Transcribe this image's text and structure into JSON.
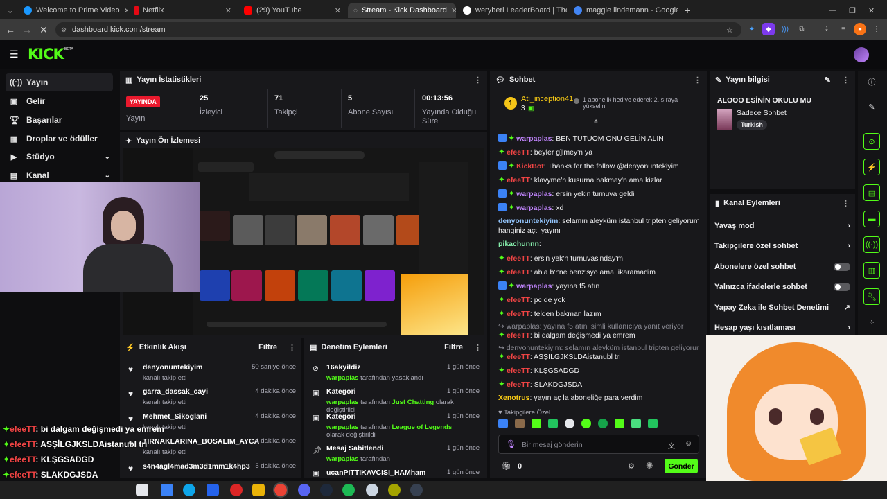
{
  "browser": {
    "tabs": [
      {
        "label": "Welcome to Prime Video",
        "color": "#1a98ff"
      },
      {
        "label": "Netflix",
        "color": "#e50914"
      },
      {
        "label": "(29) YouTube",
        "color": "#ff0000"
      },
      {
        "label": "Stream - Kick Dashboard",
        "color": "#53fc18"
      },
      {
        "label": "weryberi LeaderBoard | The be",
        "color": "#ffffff"
      },
      {
        "label": "maggie lindemann - Google'da",
        "color": "#4285f4"
      }
    ],
    "new_tab": "+",
    "url": "dashboard.kick.com/stream"
  },
  "header": {
    "logo": "KICK",
    "beta": "BETA"
  },
  "sidebar": {
    "items": [
      {
        "label": "Yayın",
        "icon": "live-icon"
      },
      {
        "label": "Gelir",
        "icon": "dollar-icon"
      },
      {
        "label": "Başarılar",
        "icon": "trophy-icon"
      },
      {
        "label": "Droplar ve ödüller",
        "icon": "gift-icon"
      },
      {
        "label": "Stüdyo",
        "icon": "video-icon"
      },
      {
        "label": "Kanal",
        "icon": "channel-icon"
      }
    ]
  },
  "stats": {
    "title": "Yayın İstatistikleri",
    "live_badge": "YAYINDA",
    "live_label": "Yayın",
    "items": [
      {
        "value": "25",
        "label": "İzleyici"
      },
      {
        "value": "71",
        "label": "Takipçi"
      },
      {
        "value": "5",
        "label": "Abone Sayısı"
      },
      {
        "value": "00:13:56",
        "label": "Yayında Olduğu Süre"
      }
    ]
  },
  "preview": {
    "title": "Yayın Ön İzlemesi"
  },
  "activity": {
    "title": "Etkinlik Akışı",
    "filter": "Filtre",
    "items": [
      {
        "name": "denyonuntekiyim",
        "sub": "kanalı takip etti",
        "time": "50 saniye önce"
      },
      {
        "name": "garra_dassak_cayi",
        "sub": "kanalı takip etti",
        "time": "4 dakika önce"
      },
      {
        "name": "Mehmet_Sikoglani",
        "sub": "kanalı takip etti",
        "time": "4 dakika önce"
      },
      {
        "name": "TIRNAKLARINA_BOSALIM_AYCA",
        "sub": "kanalı takip etti",
        "time": "4 dakika önce"
      },
      {
        "name": "s4n4agl4mad3m3d1mm1k4hp3",
        "sub": "",
        "time": "5 dakika önce"
      }
    ]
  },
  "moderation": {
    "title": "Denetim Eylemleri",
    "filter": "Filtre",
    "items": [
      {
        "name": "16akyildiz",
        "by": "warpaplas",
        "rest": " tarafından yasaklandı",
        "time": "1 gün önce"
      },
      {
        "name": "Kategori",
        "by": "warpaplas",
        "rest": " tarafından ",
        "cat": "Just Chatting",
        "end": " olarak değiştirildi",
        "time": "1 gün önce"
      },
      {
        "name": "Kategori",
        "by": "warpaplas",
        "rest": " tarafından ",
        "cat": "League of Legends",
        "end": " olarak değiştirildi",
        "time": "1 gün önce"
      },
      {
        "name": "Mesaj Sabitlendi",
        "by": "warpaplas",
        "rest": " tarafından",
        "time": "1 gün önce"
      },
      {
        "name": "ucanPITTIKAVCISI_HAMham",
        "time": "1 gün önce"
      }
    ]
  },
  "chat": {
    "title": "Sohbet",
    "gift_user": "Ati_inception41",
    "gift_count": "3",
    "gift_text": "1 abonelik hediye ederek 2. sıraya yükselin",
    "messages": [
      {
        "user": "warpaplas",
        "color": "#c084fc",
        "text": ": BEN TUTUOM ONU GELİN ALIN",
        "badges": [
          "blue",
          "grn"
        ]
      },
      {
        "user": "efeeTT",
        "color": "#ef4444",
        "text": ": beyler g]lmey'n ya",
        "badges": [
          "grn"
        ]
      },
      {
        "user": "KickBot",
        "color": "#ef4444",
        "text": ": Thanks for the follow @denyonuntekiyim",
        "badges": [
          "blue",
          "grn"
        ]
      },
      {
        "user": "efeeTT",
        "color": "#ef4444",
        "text": ": klavyme'n kusurna bakmay'n ama kizlar",
        "badges": [
          "grn"
        ]
      },
      {
        "user": "warpaplas",
        "color": "#c084fc",
        "text": ": ersin yekin turnuva geldi",
        "badges": [
          "blue",
          "grn"
        ]
      },
      {
        "user": "warpaplas",
        "color": "#c084fc",
        "text": ": xd",
        "badges": [
          "blue",
          "grn"
        ]
      },
      {
        "user": "denyonuntekiyim",
        "color": "#93c5fd",
        "text": ": selamın aleyküm istanbul tripten geliyorum",
        "badges": []
      },
      {
        "user": "",
        "color": "#efeff1",
        "text": "hanginiz açtı yayını",
        "badges": []
      },
      {
        "user": "pikachunnn",
        "color": "#86efac",
        "text": ":",
        "badges": []
      },
      {
        "user": "efeeTT",
        "color": "#ef4444",
        "text": ": ers'n yek'n turnuvas'nday'm",
        "badges": [
          "grn"
        ]
      },
      {
        "user": "efeeTT",
        "color": "#ef4444",
        "text": ": abla b'r'ne benz'syo ama .ikaramadim",
        "badges": [
          "grn"
        ]
      },
      {
        "user": "warpaplas",
        "color": "#c084fc",
        "text": ": yayına f5 atın",
        "badges": [
          "blue",
          "grn"
        ]
      },
      {
        "user": "efeeTT",
        "color": "#ef4444",
        "text": ": pc de yok",
        "badges": [
          "grn"
        ]
      },
      {
        "user": "efeeTT",
        "color": "#ef4444",
        "text": ": telden bakman lazım",
        "badges": [
          "grn"
        ]
      },
      {
        "user": "",
        "color": "#8a8a93",
        "text": "↪ warpaplas: yayına f5 atın      isimli kullanıcıya yanıt veriyor",
        "badges": []
      },
      {
        "user": "efeeTT",
        "color": "#ef4444",
        "text": ": bi dalgam değişmedi ya emrem",
        "badges": [
          "grn"
        ]
      },
      {
        "user": "",
        "color": "#8a8a93",
        "text": "↪ denyonuntekiyim: selamın aleyküm istanbul tripten geliyorum hanginiz...",
        "badges": []
      },
      {
        "user": "efeeTT",
        "color": "#ef4444",
        "text": ": ASŞİLGJKSLDAistanubl tri",
        "badges": [
          "grn"
        ]
      },
      {
        "user": "efeeTT",
        "color": "#ef4444",
        "text": ": KLŞGSADGD",
        "badges": [
          "grn"
        ]
      },
      {
        "user": "efeeTT",
        "color": "#ef4444",
        "text": ": SLAKDGJSDA",
        "badges": [
          "grn"
        ]
      },
      {
        "user": "Xenotrus",
        "color": "#facc15",
        "text": ": yayın aç la aboneliğe para verdim",
        "badges": []
      }
    ],
    "followers_only": "Takipçilere Özel",
    "input_placeholder": "Bir mesaj gönderin",
    "points": "0",
    "send": "Gönder"
  },
  "stream_info": {
    "title": "Yayın bilgisi",
    "stream_title": "ALOOO ESİNİN OKULU MU",
    "category": "Sadece Sohbet",
    "tag": "Turkish"
  },
  "channel_actions": {
    "title": "Kanal Eylemleri",
    "items": [
      {
        "label": "Yavaş mod",
        "kind": "chev"
      },
      {
        "label": "Takipçilere özel sohbet",
        "kind": "chev"
      },
      {
        "label": "Abonelere özel sohbet",
        "kind": "toggle"
      },
      {
        "label": "Yalnızca ifadelerle sohbet",
        "kind": "toggle"
      },
      {
        "label": "Yapay Zeka ile Sohbet Denetimi",
        "kind": "link"
      },
      {
        "label": "Hesap yaşı kısıtlaması",
        "kind": "chev"
      }
    ]
  },
  "overlay": {
    "lines": [
      {
        "user": "efeeTT",
        "text": ": bi dalgam değişmedi ya emrem"
      },
      {
        "user": "efeeTT",
        "text": ": ASŞİLGJKSLDAistanubl tri"
      },
      {
        "user": "efeeTT",
        "text": ": KLŞGSADGD"
      },
      {
        "user": "efeeTT",
        "text": ": SLAKDGJSDA"
      },
      {
        "user": "Xenotrus",
        "text": ": yayın aç la aboneliğe para verdim"
      }
    ]
  }
}
